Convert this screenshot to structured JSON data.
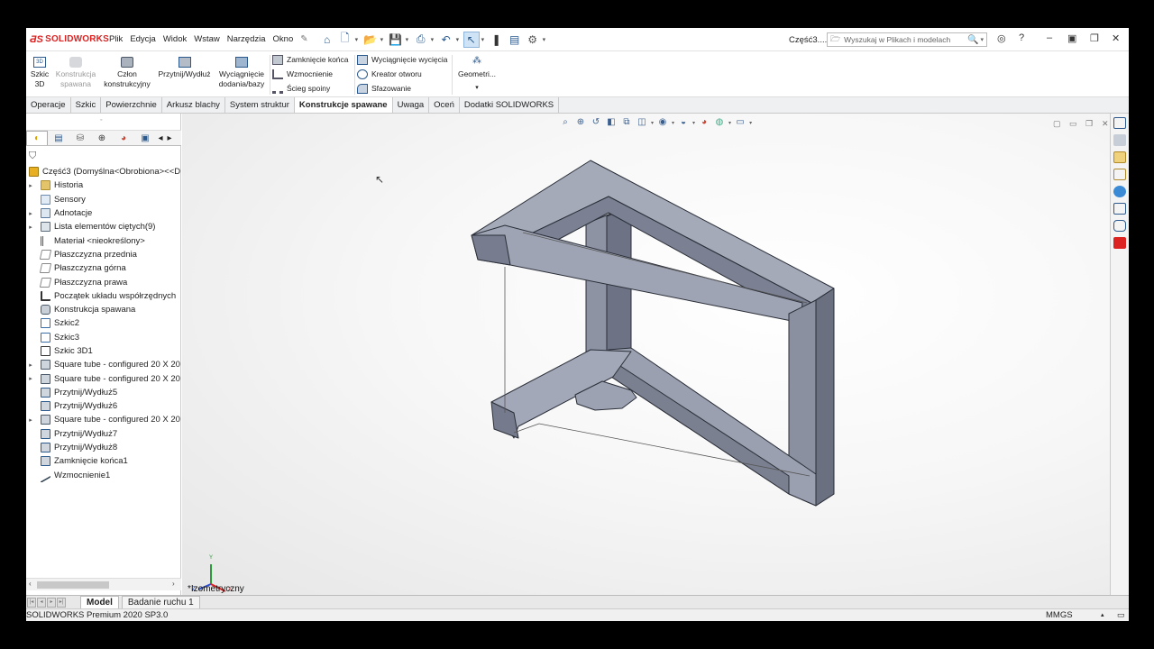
{
  "app": {
    "logo_text": "SOLIDWORKS",
    "menu": [
      "Plik",
      "Edycja",
      "Widok",
      "Wstaw",
      "Narzędzia",
      "Okno"
    ],
    "doc_title": "Część3....",
    "search_placeholder": "Wyszukaj w Plikach i modelach"
  },
  "command_manager": {
    "sketch3d_label": "Szkic\n3D",
    "weldment_label": "Konstrukcja\nspawana",
    "structural_member_label": "Człon\nkonstrukcyjny",
    "trim_extend_label": "Przytnij/Wydłuż",
    "extrude_boss_label": "Wyciągnięcie\ndodania/bazy",
    "end_cap": "Zamknięcie końca",
    "gusset": "Wzmocnienie",
    "weld_bead": "Ścieg spoiny",
    "extruded_cut": "Wyciągnięcie wycięcia",
    "hole_wizard": "Kreator otworu",
    "chamfer": "Sfazowanie",
    "ref_geometry": "Geometri...",
    "more": "▾"
  },
  "tabs": [
    {
      "label": "Operacje"
    },
    {
      "label": "Szkic"
    },
    {
      "label": "Powierzchnie"
    },
    {
      "label": "Arkusz blachy"
    },
    {
      "label": "System struktur"
    },
    {
      "label": "Konstrukcje spawane",
      "active": true
    },
    {
      "label": "Uwaga"
    },
    {
      "label": "Oceń"
    },
    {
      "label": "Dodatki SOLIDWORKS"
    }
  ],
  "tree": {
    "root": "Część3  (Domyślna<Obrobiona><<D",
    "items": [
      {
        "label": "Historia",
        "icon": "folder",
        "expandable": true
      },
      {
        "label": "Sensory",
        "icon": "sensor",
        "expandable": false
      },
      {
        "label": "Adnotacje",
        "icon": "anno",
        "expandable": true
      },
      {
        "label": "Lista elementów ciętych(9)",
        "icon": "cut",
        "expandable": true
      },
      {
        "label": "Materiał <nieokreślony>",
        "icon": "mat",
        "expandable": false
      },
      {
        "label": "Płaszczyzna przednia",
        "icon": "plane",
        "expandable": false
      },
      {
        "label": "Płaszczyzna górna",
        "icon": "plane",
        "expandable": false
      },
      {
        "label": "Płaszczyzna prawa",
        "icon": "plane",
        "expandable": false
      },
      {
        "label": "Początek układu współrzędnych",
        "icon": "origin",
        "expandable": false
      },
      {
        "label": "Konstrukcja spawana",
        "icon": "weld",
        "expandable": false
      },
      {
        "label": "Szkic2",
        "icon": "sketch",
        "expandable": false
      },
      {
        "label": "Szkic3",
        "icon": "sketch",
        "expandable": false
      },
      {
        "label": "Szkic 3D1",
        "icon": "sk3d",
        "expandable": false
      },
      {
        "label": "Square tube - configured 20 X 20",
        "icon": "tube",
        "expandable": true
      },
      {
        "label": "Square tube - configured 20 X 20",
        "icon": "tube",
        "expandable": true
      },
      {
        "label": "Przytnij/Wydłuż5",
        "icon": "trim",
        "expandable": false
      },
      {
        "label": "Przytnij/Wydłuż6",
        "icon": "trim",
        "expandable": false
      },
      {
        "label": "Square tube - configured 20 X 20",
        "icon": "tube",
        "expandable": true
      },
      {
        "label": "Przytnij/Wydłuż7",
        "icon": "trim",
        "expandable": false
      },
      {
        "label": "Przytnij/Wydłuż8",
        "icon": "trim",
        "expandable": false
      },
      {
        "label": "Zamknięcie końca1",
        "icon": "trim",
        "expandable": false
      },
      {
        "label": "Wzmocnienie1",
        "icon": "gusset",
        "expandable": false
      }
    ]
  },
  "viewport": {
    "view_label": "*Izometryczny",
    "triad": {
      "x": "X",
      "y": "Y",
      "z": "Z"
    }
  },
  "bottom_tabs": [
    {
      "label": "Model",
      "active": true
    },
    {
      "label": "Badanie ruchu 1",
      "active": false
    }
  ],
  "status": {
    "version": "SOLIDWORKS Premium 2020 SP3.0",
    "units": "MMGS"
  },
  "colors": {
    "accent_red": "#d22222",
    "tube_face": "#9ea4b3",
    "tube_dark": "#6d7384",
    "selection": "#cfe3f7"
  }
}
